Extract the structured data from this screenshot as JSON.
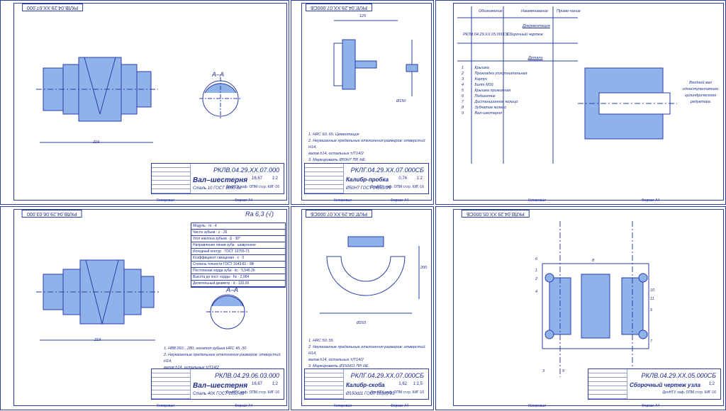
{
  "sheets": [
    {
      "stamp": "РКЛВ.04.29.XX.07.000",
      "code": "РКЛВ.04.29.XX.07.000",
      "name": "Вал–шестерня",
      "material": "Сталь 10  ГОСТ 1050-88",
      "mass": "16,67",
      "scale": "1:2",
      "org": "ДонНТУ, каф. ОПМ ст.гр. КИГ-16",
      "section": "А–А",
      "length": "219",
      "footer_left": "Копировал",
      "footer_right": "Формат А4"
    },
    {
      "stamp": "РКЛГ.04.29.XX.07.000СБ",
      "code": "РКЛГ.04.29.XX.07.000СБ",
      "name": "Калибр-пробка",
      "material": "Ø50Н7 ГОСТ 14863-29",
      "mass": "0,74",
      "scale": "1:2",
      "org": "ДонНТУ, каф. ОПМ ст.гр. КИГ-16",
      "notes": [
        "1. HRC 60..65. Цементация",
        "2. Неуказанные предельные отклонения размеров: отверстий Н14,",
        "   валов h14, остальных ±IT14/2",
        "3. Маркировать Ø50Н7 ПР, НЕ."
      ],
      "dim_125": "125",
      "dim_150": "Ø150",
      "footer_left": "Копировал",
      "footer_right": "Формат А4"
    },
    {
      "header_cols": [
        "Обозначение",
        "Наименование",
        "Приме-чание"
      ],
      "section_doc": "Документация",
      "doc_row": [
        "РКЛВ.04.29.XX.05.000СБ",
        "Сборочный чертеж"
      ],
      "section_parts": "Детали",
      "parts": [
        {
          "pos": "1",
          "name": "Крышка"
        },
        {
          "pos": "2",
          "name": "Прокладка уплотнительная"
        },
        {
          "pos": "3",
          "name": "Корпус"
        },
        {
          "pos": "4",
          "name": "Болт М16"
        },
        {
          "pos": "5",
          "name": "Крышка прижимная"
        },
        {
          "pos": "6",
          "name": "Подшипник"
        },
        {
          "pos": "7",
          "name": "Дистанционное кольцо"
        },
        {
          "pos": "8",
          "name": "Зубчатое колесо"
        },
        {
          "pos": "9",
          "name": "Вал-шестерня"
        }
      ],
      "caption": "Входной вал одноступенчатого цилиндрического редуктора",
      "footer_left": "Копировал",
      "footer_right": "Формат А4"
    },
    {
      "stamp": "РКЛВ.04.29.06.03.000",
      "code": "РКЛВ.04.29.06.03.000",
      "name": "Вал–шестерня",
      "material": "Сталь 40Х  ГОСТ 1050-88",
      "mass": "16,67",
      "scale": "1:2",
      "org": "ДонНТУ, каф. ОПМ ст.гр. КИГ-16",
      "roughness": "Ra 6,3 (√)",
      "params": [
        [
          "Модуль",
          "m",
          "4"
        ],
        [
          "Число зубьев",
          "z",
          "26"
        ],
        [
          "Угол наклона зубьев",
          "β",
          "30°"
        ],
        [
          "Направление линии зуба",
          "",
          "шевронное"
        ],
        [
          "Исходный контур",
          "",
          "ГОСТ 13755-71"
        ],
        [
          "Коэффициент смещения",
          "x",
          "0"
        ],
        [
          "Степень точности ГОСТ 1643-81",
          "",
          "9B"
        ],
        [
          "Постоянная хорда зуба",
          "s̄c",
          "5,546 2h"
        ],
        [
          "Высота до пост. хорды",
          "h̄c",
          "2,984"
        ],
        [
          "Делительный диаметр",
          "d",
          "120,09"
        ]
      ],
      "notes": [
        "1. НВ8 260…280, зонатоп зубьев HRC 45..50",
        "2. Неуказанные предельные отклонения размеров: отверстий Н14,",
        "   валов h14, остальных ±IT14/2"
      ],
      "section": "А–А",
      "length": "219",
      "footer_left": "Копировал",
      "footer_right": "Формат А4"
    },
    {
      "stamp": "РКЛГ.04.29.XX.07.000СБ",
      "code": "РКЛГ.04.29.XX.07.000СБ",
      "name": "Калибр-скоба",
      "material": "Ø150d11 ГОСТ 18360-93",
      "mass": "1,62",
      "scale": "1:2,5",
      "org": "ДонНТУ, каф. ОПМ ст.гр. КИГ-16",
      "notes": [
        "1. HRC 50..55",
        "2. Неуказанные предельные отклонения размеров: отверстий Н14,",
        "   валов h14, остальных ±IT14/2",
        "3. Маркировать Ø150d11 ПР, НЕ."
      ],
      "dim_265": "Ø265",
      "dim_200": "200",
      "footer_left": "Копировал",
      "footer_right": "Формат А4"
    },
    {
      "stamp": "РКЛВ.04.29.XX.05.000СБ",
      "code": "РКЛВ.04.29.XX.05.000СБ",
      "name": "Сборочный чертеж узла",
      "mass": "",
      "scale": "1:2",
      "org": "ДонНТУ, каф. ОПМ ст.гр. КИГ-16",
      "labels": [
        "1",
        "2",
        "3",
        "4",
        "5",
        "6",
        "7",
        "8",
        "9",
        "10",
        "11"
      ],
      "footer_left": "Копировал",
      "footer_right": "Формат А4"
    }
  ],
  "colors": {
    "ink": "#2b3ea6",
    "fill": "#8fb2ea",
    "paper": "#ffffff"
  }
}
